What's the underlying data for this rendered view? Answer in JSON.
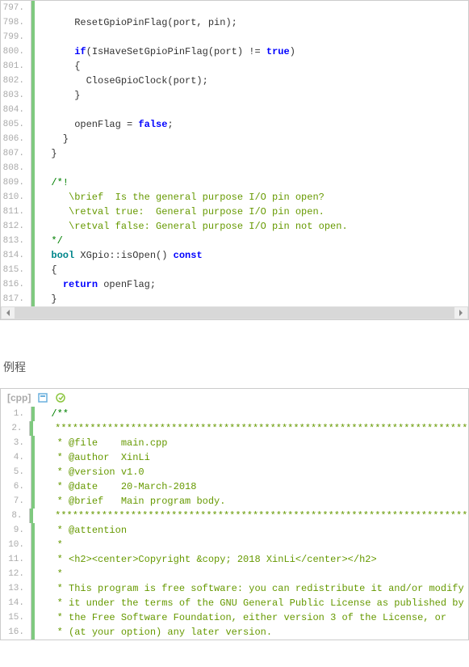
{
  "block1": {
    "lines": [
      {
        "n": "797.",
        "segs": [
          {
            "t": "",
            "c": ""
          }
        ]
      },
      {
        "n": "798.",
        "segs": [
          {
            "t": "      ResetGpioPinFlag(port, pin);",
            "c": ""
          }
        ]
      },
      {
        "n": "799.",
        "segs": [
          {
            "t": "",
            "c": ""
          }
        ]
      },
      {
        "n": "800.",
        "segs": [
          {
            "t": "      ",
            "c": ""
          },
          {
            "t": "if",
            "c": "kw-blue"
          },
          {
            "t": "(IsHaveSetGpioPinFlag(port) != ",
            "c": ""
          },
          {
            "t": "true",
            "c": "kw-blue"
          },
          {
            "t": ")",
            "c": ""
          }
        ]
      },
      {
        "n": "801.",
        "segs": [
          {
            "t": "      {",
            "c": ""
          }
        ]
      },
      {
        "n": "802.",
        "segs": [
          {
            "t": "        CloseGpioClock(port);",
            "c": ""
          }
        ]
      },
      {
        "n": "803.",
        "segs": [
          {
            "t": "      }",
            "c": ""
          }
        ]
      },
      {
        "n": "804.",
        "segs": [
          {
            "t": "",
            "c": ""
          }
        ]
      },
      {
        "n": "805.",
        "segs": [
          {
            "t": "      openFlag = ",
            "c": ""
          },
          {
            "t": "false",
            "c": "kw-blue"
          },
          {
            "t": ";",
            "c": ""
          }
        ]
      },
      {
        "n": "806.",
        "segs": [
          {
            "t": "    }",
            "c": ""
          }
        ]
      },
      {
        "n": "807.",
        "segs": [
          {
            "t": "  }",
            "c": ""
          }
        ]
      },
      {
        "n": "808.",
        "segs": [
          {
            "t": "",
            "c": ""
          }
        ]
      },
      {
        "n": "809.",
        "segs": [
          {
            "t": "  ",
            "c": ""
          },
          {
            "t": "/*!",
            "c": "comment-green"
          }
        ]
      },
      {
        "n": "810.",
        "segs": [
          {
            "t": "     \\brief  Is the general purpose I/O pin open?",
            "c": "comment-olive"
          }
        ]
      },
      {
        "n": "811.",
        "segs": [
          {
            "t": "     \\retval true:  General purpose I/O pin open.",
            "c": "comment-olive"
          }
        ]
      },
      {
        "n": "812.",
        "segs": [
          {
            "t": "     \\retval false: General purpose I/O pin not open.",
            "c": "comment-olive"
          }
        ]
      },
      {
        "n": "813.",
        "segs": [
          {
            "t": "  ",
            "c": ""
          },
          {
            "t": "*/",
            "c": "comment-green"
          }
        ]
      },
      {
        "n": "814.",
        "segs": [
          {
            "t": "  ",
            "c": ""
          },
          {
            "t": "bool",
            "c": "type-teal"
          },
          {
            "t": " XGpio::isOpen() ",
            "c": ""
          },
          {
            "t": "const",
            "c": "kw-blue"
          }
        ]
      },
      {
        "n": "815.",
        "segs": [
          {
            "t": "  {",
            "c": ""
          }
        ]
      },
      {
        "n": "816.",
        "segs": [
          {
            "t": "    ",
            "c": ""
          },
          {
            "t": "return",
            "c": "kw-blue"
          },
          {
            "t": " openFlag;",
            "c": ""
          }
        ]
      },
      {
        "n": "817.",
        "segs": [
          {
            "t": "  }",
            "c": ""
          }
        ]
      }
    ]
  },
  "section_label": "例程",
  "block2": {
    "header_label": "[cpp]",
    "lines": [
      {
        "n": "1.",
        "segs": [
          {
            "t": "  ",
            "c": ""
          },
          {
            "t": "/**",
            "c": "comment-green"
          }
        ]
      },
      {
        "n": "2.",
        "segs": [
          {
            "t": "   ",
            "c": ""
          },
          {
            "t": "******************************************************************************",
            "c": "comment-olive"
          }
        ]
      },
      {
        "n": "3.",
        "segs": [
          {
            "t": "   ",
            "c": ""
          },
          {
            "t": "* @file    main.cpp",
            "c": "comment-olive"
          }
        ]
      },
      {
        "n": "4.",
        "segs": [
          {
            "t": "   ",
            "c": ""
          },
          {
            "t": "* @author  XinLi",
            "c": "comment-olive"
          }
        ]
      },
      {
        "n": "5.",
        "segs": [
          {
            "t": "   ",
            "c": ""
          },
          {
            "t": "* @version v1.0",
            "c": "comment-olive"
          }
        ]
      },
      {
        "n": "6.",
        "segs": [
          {
            "t": "   ",
            "c": ""
          },
          {
            "t": "* @date    20-March-2018",
            "c": "comment-olive"
          }
        ]
      },
      {
        "n": "7.",
        "segs": [
          {
            "t": "   ",
            "c": ""
          },
          {
            "t": "* @brief   Main program body.",
            "c": "comment-olive"
          }
        ]
      },
      {
        "n": "8.",
        "segs": [
          {
            "t": "   ",
            "c": ""
          },
          {
            "t": "******************************************************************************",
            "c": "comment-olive"
          }
        ]
      },
      {
        "n": "9.",
        "segs": [
          {
            "t": "   ",
            "c": ""
          },
          {
            "t": "* @attention",
            "c": "comment-olive"
          }
        ]
      },
      {
        "n": "10.",
        "segs": [
          {
            "t": "   ",
            "c": ""
          },
          {
            "t": "*",
            "c": "comment-olive"
          }
        ]
      },
      {
        "n": "11.",
        "segs": [
          {
            "t": "   ",
            "c": ""
          },
          {
            "t": "* <h2><center>Copyright &copy; 2018 XinLi</center></h2>",
            "c": "comment-olive"
          }
        ]
      },
      {
        "n": "12.",
        "segs": [
          {
            "t": "   ",
            "c": ""
          },
          {
            "t": "*",
            "c": "comment-olive"
          }
        ]
      },
      {
        "n": "13.",
        "segs": [
          {
            "t": "   ",
            "c": ""
          },
          {
            "t": "* This program is free software: you can redistribute it and/or modify",
            "c": "comment-olive"
          }
        ]
      },
      {
        "n": "14.",
        "segs": [
          {
            "t": "   ",
            "c": ""
          },
          {
            "t": "* it under the terms of the GNU General Public License as published by",
            "c": "comment-olive"
          }
        ]
      },
      {
        "n": "15.",
        "segs": [
          {
            "t": "   ",
            "c": ""
          },
          {
            "t": "* the Free Software Foundation, either version 3 of the License, or",
            "c": "comment-olive"
          }
        ]
      },
      {
        "n": "16.",
        "segs": [
          {
            "t": "   ",
            "c": ""
          },
          {
            "t": "* (at your option) any later version.",
            "c": "comment-olive"
          }
        ]
      }
    ]
  }
}
